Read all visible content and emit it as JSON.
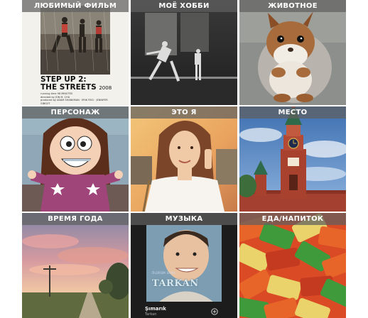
{
  "tiles": [
    {
      "label": "ЛЮБИМЫЙ ФИЛЬМ"
    },
    {
      "label": "МОЁ ХОББИ"
    },
    {
      "label": "ЖИВОТНОЕ"
    },
    {
      "label": "ПЕРСОНАЖ"
    },
    {
      "label": "ЭТО Я"
    },
    {
      "label": "МЕСТО"
    },
    {
      "label": "ВРЕМЯ ГОДА"
    },
    {
      "label": "МУЗЫКА"
    },
    {
      "label": "ЕДА/НАПИТОК"
    }
  ],
  "poster": {
    "title_line1": "STEP UP 2:",
    "title_line2": "THE STREETS",
    "year": "2008",
    "fine_line1": "running time 98 MINUTES",
    "fine_line2": "directed by JON M. CHU",
    "fine_line3": "produced by ADAM SHANKMAN · ERIK FEIG · JENNIFER GIBGOT"
  },
  "album": {
    "cover_text": "TARKAN",
    "cover_small": "ÖLÜRÜM SANA",
    "track": "Şımarık",
    "artist": "Tarkan",
    "add_icon": "plus-circle-icon"
  },
  "colors": {
    "label_bg": "#5f5f5f",
    "label_text": "#ffffff"
  }
}
